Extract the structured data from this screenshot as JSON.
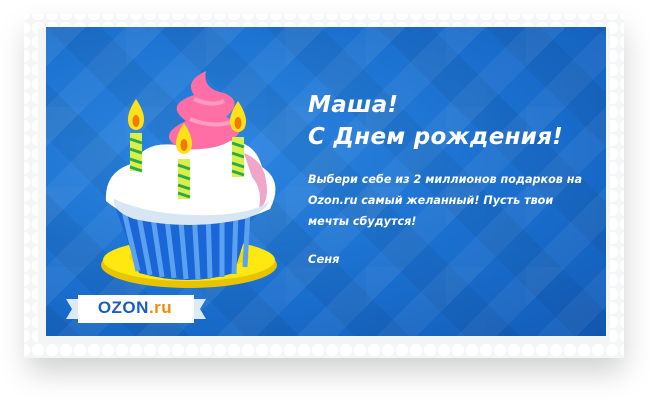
{
  "greeting": {
    "name": "Маша!",
    "title": "С Днем рождения!",
    "message": "Выбери себе из 2 миллионов подарков на Ozon.ru самый желанный! Пусть твои мечты сбудутся!",
    "signature": "Сеня"
  },
  "logo": {
    "main": "OZON",
    "tld": ".ru",
    "icon": "ozon-logo"
  },
  "illustration": {
    "icon": "birthday-cupcake-with-candles",
    "candles": 3
  },
  "colors": {
    "background": "#1a6fce",
    "text": "#ffffff",
    "brand_blue": "#1a5fc0",
    "brand_orange": "#f28c00"
  }
}
